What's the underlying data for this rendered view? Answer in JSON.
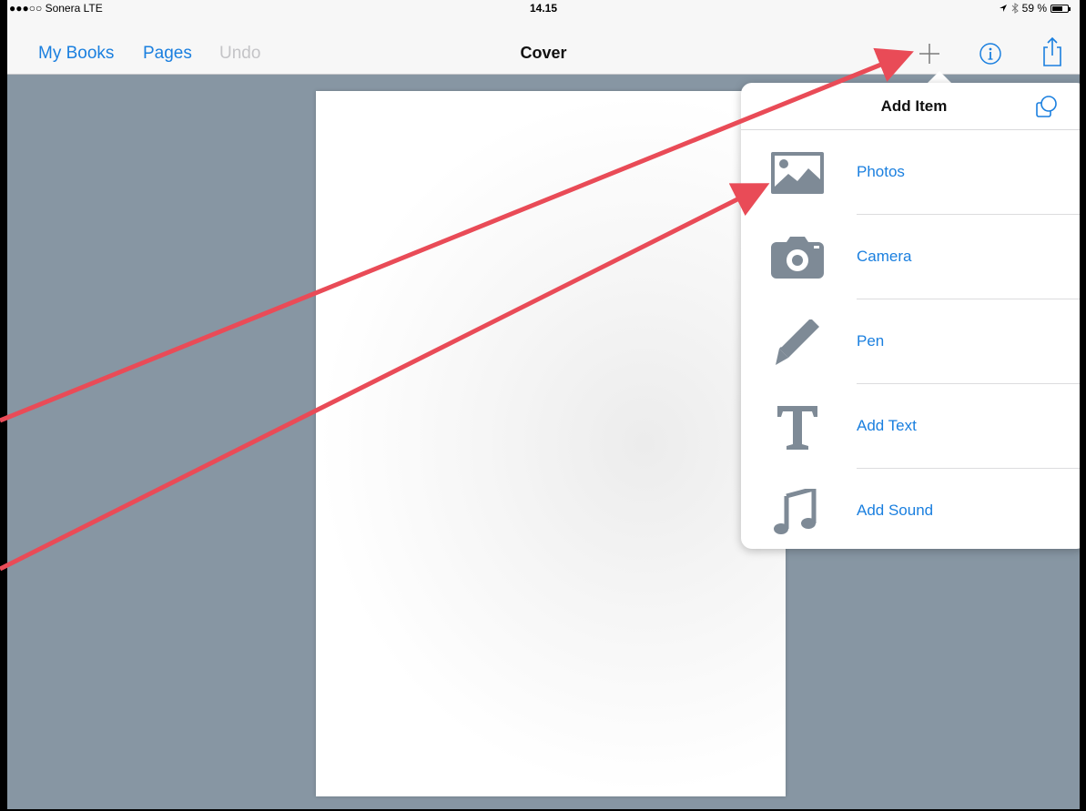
{
  "status_bar": {
    "carrier": "●●●○○ Sonera  LTE",
    "time": "14.15",
    "battery": "59 %",
    "battery_level": 0.59
  },
  "nav": {
    "my_books": "My Books",
    "pages": "Pages",
    "undo": "Undo",
    "title": "Cover"
  },
  "popover": {
    "title": "Add Item",
    "items": [
      {
        "label": "Photos",
        "icon": "photos-icon"
      },
      {
        "label": "Camera",
        "icon": "camera-icon"
      },
      {
        "label": "Pen",
        "icon": "pen-icon"
      },
      {
        "label": "Add Text",
        "icon": "text-icon"
      },
      {
        "label": "Add Sound",
        "icon": "music-note-icon"
      }
    ]
  },
  "colors": {
    "accent": "#1a7fdf",
    "background": "#8796a3",
    "annotation_arrow": "#e94b57",
    "icon_gray": "#7e8a96"
  }
}
